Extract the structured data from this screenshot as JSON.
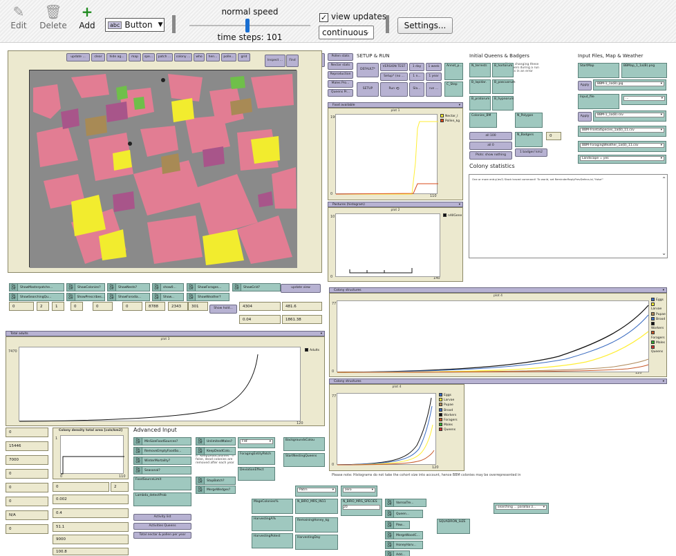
{
  "toolbar": {
    "edit": "Edit",
    "delete": "Delete",
    "add": "Add",
    "widget_type": "Button",
    "speed_label": "normal speed",
    "time_steps": "time steps: 101",
    "view_updates": "view updates",
    "update_mode": "continuous",
    "settings": "Settings...",
    "view_updates_checked": true
  },
  "top_row": {
    "val1": "102",
    "val2": "100",
    "date": "11 April 1",
    "buttons": [
      "update ...",
      "clear",
      "hide ag...",
      "map",
      "spe...",
      "patch ...",
      "colony ...",
      "who",
      "hen...",
      "polle...",
      "grid",
      "Inspect ...",
      "Find"
    ],
    "inspect_tile": "InspectTile"
  },
  "side_buttons": [
    "Pollen stats",
    "Nectar stats",
    "Reproduction",
    "Males Pro...",
    "Queens Pr..."
  ],
  "setup_run": {
    "title": "SETUP & RUN",
    "default": "DEFAULT*",
    "version": "VERSION TEST",
    "setup_cmd": "Setup* (no ...",
    "setup": "SETUP",
    "run": "Run",
    "sla": "Sla...",
    "run2": "run ...",
    "day1": "1 day",
    "week1": "1 week",
    "n1": "1 n...",
    "year1": "1 year",
    "annot": "Annot_p...",
    "cstep": "C_Step"
  },
  "food_chooser": "Food available",
  "plot1": {
    "title": "plot 1",
    "ymax": "1960",
    "xmin": "0",
    "xmax": "110",
    "legend": [
      {
        "name": "Nectar_l",
        "color": "#ffee33"
      },
      {
        "name": "Pollen_kg",
        "color": "#d94a1a"
      }
    ]
  },
  "pastures_chooser": "Pastures (histogram)",
  "plot2": {
    "title": "plot 2",
    "ymax": "10",
    "xmin": "0",
    "xmax": "140",
    "legend": [
      {
        "name": "nAllGene",
        "color": "#111111"
      }
    ]
  },
  "queens": {
    "title": "Initial Queens & Badgers",
    "note": "Note: changing these numbers during a run results in an error",
    "inputs": [
      "N_terrestr.",
      "B_hortorum",
      "B_lapidar.",
      "B_pascuorum",
      "B_pratorum",
      "B_hypnorum"
    ],
    "colonies": "Colonies_BM",
    "all100": "all 100",
    "all0": "all 0",
    "plots_show": "Plots: show nothing",
    "nbadgers": "N_Badgers",
    "badger_val": "0",
    "badger_btn": "1 badger/ km2",
    "n_polygon": "N_Polygon"
  },
  "input_files": {
    "title": "Input Files, Map & Weather",
    "startmap": "StartMap",
    "bbmap": "BBMap_1_1a(B).png",
    "apply1": "Apply",
    "mapsize": "BBM-1_1a(B).jpg",
    "input_file": "Input_file",
    "apply2": "Apply",
    "chooser2": "BBM-1_1a(B).csv",
    "weather": "BBM-FrontalSpecies_1a(B)_11.csv",
    "forage": "BBM-ForagingWeather_1a(B)_11.csv",
    "limit": "Landscape = yes",
    "note2": "(only used to calculate density)"
  },
  "colony_stats": {
    "title": "Colony statistics",
    "text": "One or more entry(ies?) Stack traced command! 'To world, set ReminderReplyPrevDefecs-is\\ \"false\"'"
  },
  "switches_row": [
    "ShowMasterpatche...",
    "ShowColonies?",
    "ShowNests?",
    "show0...",
    "ShowForages...",
    "ShowGrid?",
    "ShowSearchingQu...",
    "ShowPrescribes...",
    "ShowForodia...",
    "Show...",
    "ShowWeather?"
  ],
  "update_view": "update view",
  "numbers_row": [
    "0",
    "2",
    "1",
    "0",
    "0",
    "0",
    "8788",
    "2343",
    "301"
  ],
  "show_hold": "Show hold...",
  "mon_right": {
    "a": "4304",
    "b": "481.6",
    "c": "0.04",
    "d": "1861.38"
  },
  "plot5_chooser": "Colony structures",
  "plot5": {
    "title": "plot 4",
    "ymax": "7710",
    "xmin": "0",
    "xmax": "120"
  },
  "plot6": {
    "title": "plot 4",
    "ymax": "7710",
    "xmin": "0",
    "xmax": "120"
  },
  "legend_castes": [
    {
      "name": "Eggs",
      "color": "#3b6cc0"
    },
    {
      "name": "Larvae",
      "color": "#ffee33"
    },
    {
      "name": "Pupae",
      "color": "#b08a5a"
    },
    {
      "name": "Brood",
      "color": "#3b6cc0"
    },
    {
      "name": "Workers",
      "color": "#111111"
    },
    {
      "name": "Foragers",
      "color": "#c85a2a"
    },
    {
      "name": "Males",
      "color": "#33aa33"
    },
    {
      "name": "Queens",
      "color": "#cc3333"
    }
  ],
  "total_chooser": "Total adults",
  "plot3": {
    "title": "plot 3",
    "ymax": "7470",
    "xmin": "0",
    "xmax": "120",
    "legend": [
      {
        "name": "Adults",
        "color": "#111111"
      }
    ]
  },
  "left_mons": [
    "0",
    "15446",
    "7000",
    "0",
    "0",
    "0",
    "N/A",
    "0"
  ],
  "density": {
    "title": "Colony density total area [cols/km2]",
    "ymax": "1",
    "xmin": "0",
    "xmax": "110"
  },
  "density_vals": [
    "0",
    "2",
    "0.002",
    "0.4",
    "51.1",
    "9000",
    "100.8"
  ],
  "advanced": {
    "title": "Advanced Input",
    "switches": [
      "MinSizeFoodSources?",
      "RemoveEmptyFoodSo...",
      "WinterMortality?",
      "Seasonal?",
      "UnlimitedMales?",
      "KeepDeadColo...",
      "StopBatch?",
      "MergeWedges?"
    ],
    "note": "If \"KeepDeadColonies\" = false, dead colonies are removed after each year",
    "foodsource": "FoodSourceLimit",
    "lambda": "Lambda_detectProb",
    "forager": "ForagingProb",
    "activity": "Activity list",
    "activities_queens": "Activities Queens",
    "total_nectar": "Total nectar & pollen per year",
    "dd1": "FHF",
    "seg": "ForagingEntityPatch",
    "stddev": "DeviationEffect",
    "bg": "BackgroundsColou",
    "start_nest": "StartNestingQueens"
  },
  "bottom": {
    "note": "Please note: Histograms do not take the cohort size into account, hence BBM colonies may be overrepresented in",
    "dd_patrn": "Patrn",
    "dd_zero": "zero",
    "mage": "MageColonies%",
    "nbiro": "N_BIRO_MRS_IN11",
    "nbiro2": "N_BIRO_MRS_SPECIES",
    "val20": "20",
    "harv": "HarvestingA%",
    "harv2": "RemainingHoney_kg",
    "harv3": "HarvestingPotest",
    "harvday": "HarvestingDay",
    "sw1": "VarroaTre...",
    "sw2": "Queen...",
    "sw3": "Paw...",
    "sw4": "MergeWoodC...",
    "sw5": "HoneyHarv...",
    "sw6": "Add...",
    "squadron": "SQUADRON_SIZE",
    "search": "searching ... parallax z..."
  }
}
